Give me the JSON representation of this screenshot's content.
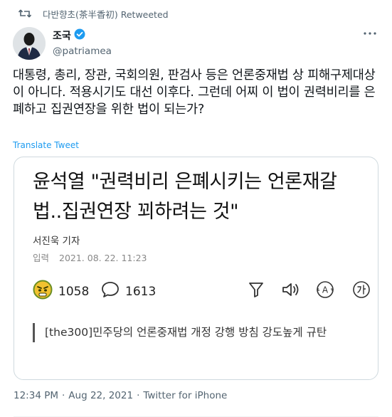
{
  "retweet": {
    "icon": "retweet-icon",
    "label": "다반향초(茶半香初) Retweeted"
  },
  "author": {
    "name": "조국",
    "handle": "@patriamea",
    "verified": true,
    "verified_color": "#1d9bf0"
  },
  "tweet": {
    "text": "대통령, 총리, 장관, 국회의원, 판검사 등은 언론중재법 상 피해구제대상이 아니다. 적용시기도 대선 이후다. 그런데 어찌 이 법이 권력비리를 은폐하고 집권연장을 위한 법이 되는가?",
    "translate_label": "Translate Tweet"
  },
  "card": {
    "headline": "윤석열 \"권력비리 은폐시키는 언론재갈 법..집권연장 꾀하려는 것\"",
    "reporter": "서진욱 기자",
    "date_label": "입력",
    "date_value": "2021. 08. 22. 11:23",
    "reaction_angry_count": "1058",
    "comment_count": "1613",
    "subhead": "[the300]민주당의 언론중재법 개정 강행 방침 강도높게 규탄"
  },
  "meta": {
    "time": "12:34 PM",
    "dot1": "·",
    "date": "Aug 22, 2021",
    "dot2": "·",
    "client": "Twitter for iPhone"
  },
  "colors": {
    "link": "#1d9bf0",
    "muted": "#536471",
    "text": "#0f1419",
    "card_border": "#cfd9de"
  }
}
